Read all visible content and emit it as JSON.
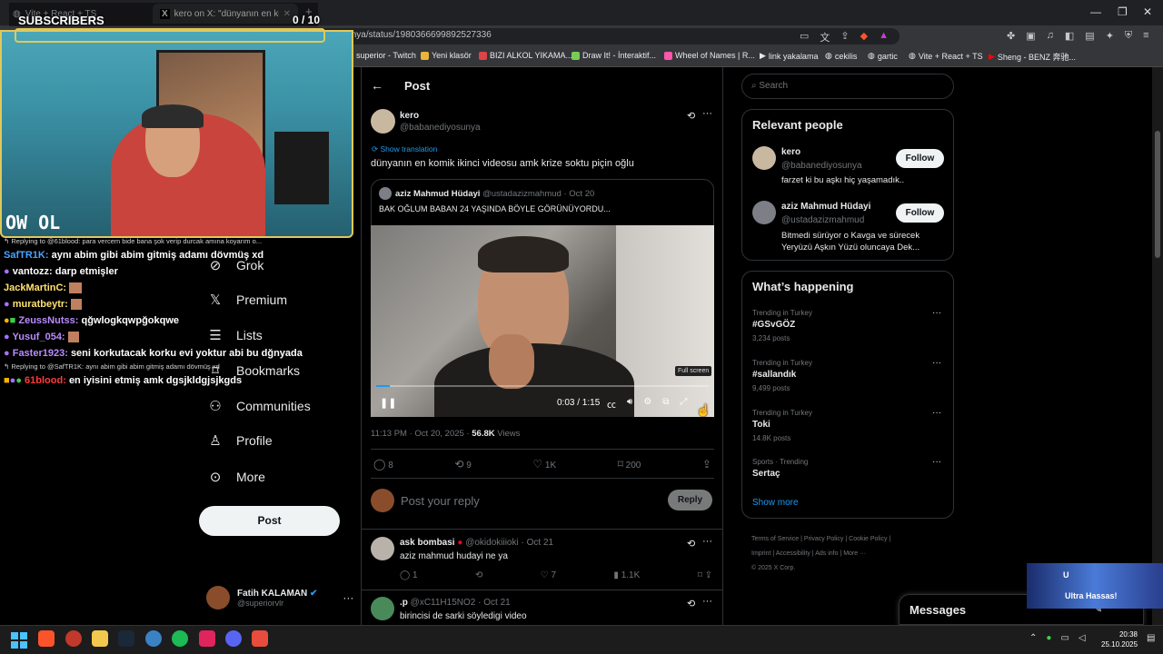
{
  "browser": {
    "tabs": [
      {
        "label": "Vite + React + TS"
      },
      {
        "label": "kero on X: \"dünyanın en kom"
      }
    ],
    "url": "x.com/babanediyosunya/status/1980366699892527336",
    "bookmarks": [
      "superior - Twitch",
      "Yeni klasör",
      "BIZI ALKOL YIKAMA...",
      "Draw It! - İnteraktif...",
      "Wheel of Names | R...",
      "link yakalama",
      "cekilis",
      "gartic",
      "Vite + React + TS",
      "Sheng - BENZ 奔驰..."
    ]
  },
  "overlay": {
    "subscribers_label": "SUBSCRIBERS",
    "subscribers_count": "0 / 10",
    "cam_logo": "OW OL",
    "chat": [
      {
        "type": "reply",
        "text": "Replying to @61blood: para vercem bide bana şok verip durcak amına koyarım o..."
      },
      {
        "user": "SafTR1K:",
        "msg": "aynı abim gibi abim gitmiş adamı dövmüş xd",
        "color": "#4aa3ff"
      },
      {
        "user": "vantozz:",
        "msg": "darp etmişler",
        "color": "#ffffff"
      },
      {
        "user": "JackMartinC:",
        "msg": "",
        "color": "#ffe270"
      },
      {
        "user": "muratbeytr:",
        "msg": "",
        "color": "#ffe270"
      },
      {
        "user": "ZeussNutss:",
        "msg": "qğwlogkqwpğokqwe",
        "color": "#b98cff"
      },
      {
        "user": "Yusuf_054:",
        "msg": "",
        "color": "#b98cff"
      },
      {
        "user": "Faster1923:",
        "msg": "seni korkutacak korku evi yoktur abi bu dğnyada",
        "color": "#b98cff"
      },
      {
        "type": "reply",
        "text": "Replying to @SafTR1K: aynı abim gibi abim gitmiş adamı dövmüş xd"
      },
      {
        "user": "61blood:",
        "msg": "en iyisini etmiş amk dgsjkldgjsjkgds",
        "color": "#ff3b3b"
      }
    ],
    "alert_lines": [
      "U",
      "Ultra Hassas!"
    ]
  },
  "nav": {
    "items": [
      {
        "label": "Grok",
        "icon": "grok-icon"
      },
      {
        "label": "Premium",
        "icon": "x-logo-icon"
      },
      {
        "label": "Lists",
        "icon": "list-icon"
      },
      {
        "label": "Bookmarks",
        "icon": "bookmark-icon"
      },
      {
        "label": "Communities",
        "icon": "communities-icon"
      },
      {
        "label": "Profile",
        "icon": "profile-icon"
      },
      {
        "label": "More",
        "icon": "more-icon"
      }
    ],
    "post_button": "Post",
    "account": {
      "name": "Fatih KALAMAN",
      "handle": "@superiorvlr"
    }
  },
  "post": {
    "header_title": "Post",
    "author_name": "kero",
    "author_handle": "@babanediyosunya",
    "show_translation": "Show translation",
    "text": "dünyanın en komik ikinci videosu amk krize soktu piçin oğlu",
    "quote": {
      "name": "aziz Mahmud Hüdayi",
      "handle": "@ustadazizmahmud",
      "date": "· Oct 20",
      "text": "BAK OĞLUM BABAN 24 YAŞINDA BÖYLE GÖRÜNÜYORDU..."
    },
    "video": {
      "time": "0:03 / 1:15",
      "tooltip": "Full screen",
      "progress": 0.04
    },
    "timestamp": "11:13 PM · Oct 20, 2025 · ",
    "views_count": "56.8K",
    "views_label": " Views",
    "stats": {
      "replies": "8",
      "reposts": "9",
      "likes": "1K",
      "bookmarks": "200"
    },
    "reply_placeholder": "Post your reply",
    "reply_button": "Reply"
  },
  "replies": [
    {
      "name": "ask bombasi",
      "handle": "@okidokiiioki",
      "date": "· Oct 21",
      "text": "aziz mahmud hudayi ne ya",
      "stats": {
        "replies": "1",
        "reposts": "",
        "likes": "7",
        "views": "1.1K"
      }
    },
    {
      "name": ".p",
      "handle": "@xC11H15NO2",
      "date": "· Oct 21",
      "text": "birincisi de sarki söyledigi video"
    }
  ],
  "sidebar": {
    "search_placeholder": "Search",
    "relevant_title": "Relevant people",
    "people": [
      {
        "name": "kero",
        "handle": "@babanediyosunya",
        "bio": "farzet ki bu aşkı hiç yaşamadık..",
        "follow": "Follow"
      },
      {
        "name": "aziz Mahmud Hüdayi",
        "handle": "@ustadazizmahmud",
        "bio": "Bitmedi sürüyor o Kavga ve sürecek Yeryüzü Aşkın Yüzü oluncaya Dek...",
        "follow": "Follow"
      }
    ],
    "happening_title": "What’s happening",
    "trends": [
      {
        "category": "Trending in Turkey",
        "name": "#GSvGÖZ",
        "count": "3,234 posts"
      },
      {
        "category": "Trending in Turkey",
        "name": "#sallandık",
        "count": "9,499 posts"
      },
      {
        "category": "Trending in Turkey",
        "name": "Toki",
        "count": "14.8K posts"
      },
      {
        "category": "Sports · Trending",
        "name": "Sertaç",
        "count": ""
      }
    ],
    "show_more": "Show more",
    "footer": [
      "Terms of Service",
      "Privacy Policy",
      "Cookie Policy",
      "Imprint",
      "Accessibility",
      "Ads info",
      "More ···",
      "© 2025 X Corp."
    ],
    "messages": "Messages"
  },
  "taskbar": {
    "time": "20:38",
    "date": "25.10.2025"
  },
  "colors": {
    "accent": "#1d9bf0",
    "bg": "#000000",
    "border": "#2f3336"
  }
}
